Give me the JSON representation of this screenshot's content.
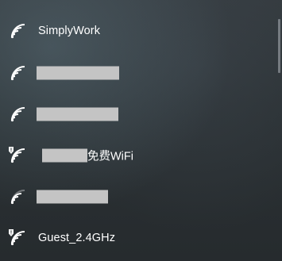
{
  "networks": [
    {
      "ssid": "SimplyWork",
      "secured": true,
      "signal": "strong",
      "redacted": false
    },
    {
      "ssid": "",
      "secured": true,
      "signal": "strong",
      "redacted": true
    },
    {
      "ssid": "",
      "secured": true,
      "signal": "strong",
      "redacted": true
    },
    {
      "ssid_visible_suffix": "免费WiFi",
      "secured": false,
      "signal": "strong",
      "redacted_prefix": true
    },
    {
      "ssid": "",
      "secured": true,
      "signal": "medium",
      "redacted": true
    },
    {
      "ssid": "Guest_2.4GHz",
      "secured": false,
      "signal": "strong",
      "redacted": false
    }
  ],
  "icons": {
    "wifi": "wifi-signal-icon",
    "wifi_open": "wifi-open-network-icon"
  },
  "colors": {
    "text": "#ffffff",
    "redaction": "#c4c4c4",
    "background": "#2b3134"
  }
}
